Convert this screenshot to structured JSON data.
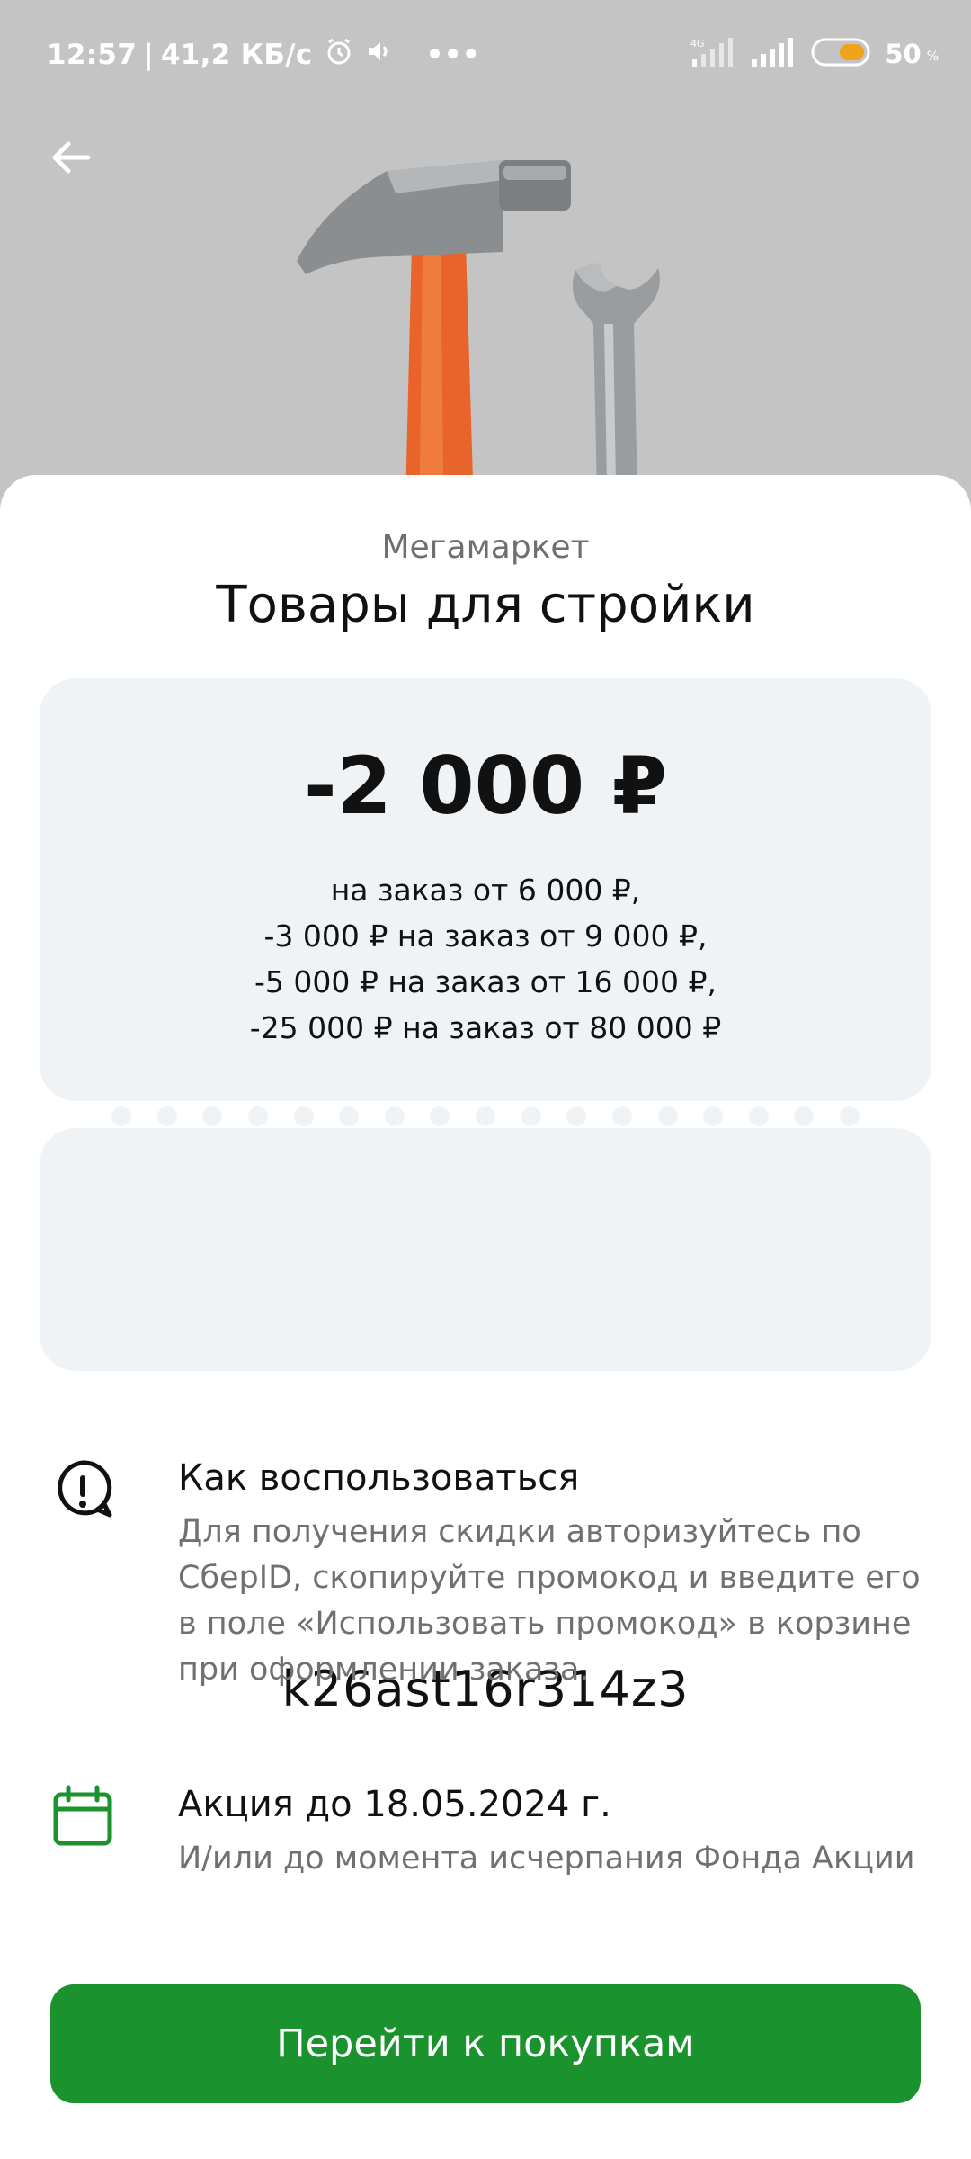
{
  "status_bar": {
    "time": "12:57",
    "speed": "41,2 КБ/с",
    "more": "•••",
    "network": "4G",
    "battery": "50"
  },
  "hero": {
    "image": "hammer and wrench on grey background"
  },
  "offer": {
    "merchant": "Мегамаркет",
    "title": "Товары для стройки",
    "amount": "-2 000 ₽",
    "conditions": [
      "на заказ от 6 000 ₽,",
      "-3 000 ₽ на заказ от 9 000 ₽,",
      "-5 000 ₽ на заказ от 16 000 ₽,",
      "-25 000 ₽ на заказ от 80 000 ₽"
    ],
    "promo_code": "k26ast16r314z3"
  },
  "how_to": {
    "title": "Как воспользоваться",
    "text": "Для получения скидки авторизуйтесь по СберID, скопируйте промокод и введите его в поле «Использовать промокод» в корзине при оформлении заказа."
  },
  "validity": {
    "title": "Акция до 18.05.2024 г.",
    "text": "И/или до момента исчерпания Фонда Акции"
  },
  "cta": {
    "label": "Перейти к покупкам"
  },
  "colors": {
    "accent": "#1a922e",
    "card_bg": "#f0f3f6",
    "hero_bg": "#c4c4c4",
    "battery": "#f0a21a"
  }
}
